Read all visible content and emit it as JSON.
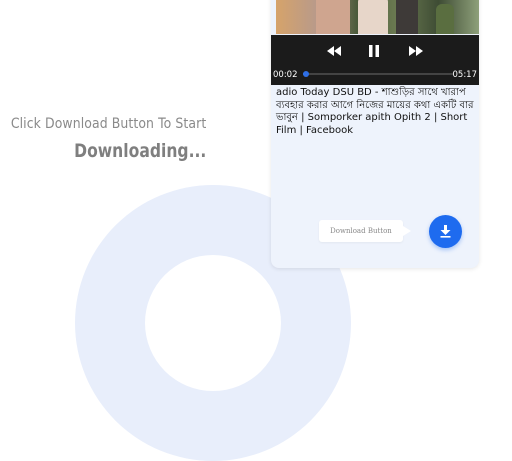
{
  "headline": {
    "line1": "Click Download Button To Start",
    "line2": "Downloading..."
  },
  "player": {
    "rewind_icon": "rewind-icon",
    "pause_icon": "pause-icon",
    "forward_icon": "fast-forward-icon",
    "current_time": "00:02",
    "duration": "05:17",
    "progress": 0.02
  },
  "video": {
    "title": "adio Today DSU BD - শাশুড়ির সাথে খারাপ ব্যবহার করার আগে নিজের মায়ের কথা একটি বার ভাবুন | Somporker apith Opith 2 | Short Film | Facebook"
  },
  "download": {
    "tooltip": "Download Button",
    "button_icon": "download-icon"
  },
  "colors": {
    "accent": "#1e6bef",
    "card_bg": "#eef3fc",
    "player_bg": "#1b1b1b",
    "headline": "#8a8a8a"
  }
}
